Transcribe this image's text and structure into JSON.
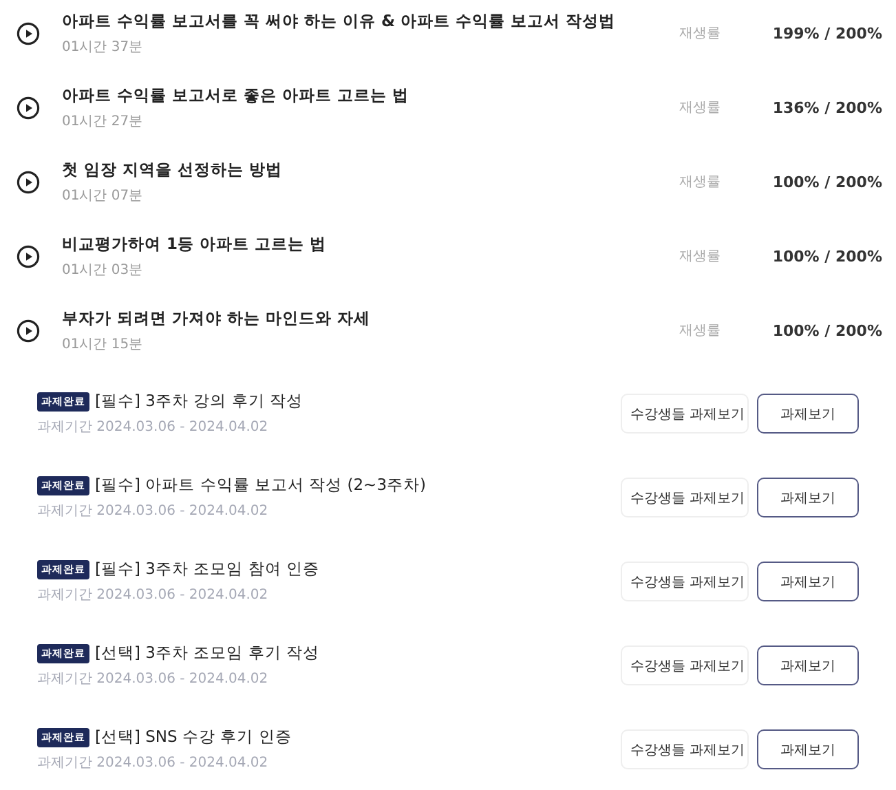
{
  "lectures": [
    {
      "title": "아파트 수익률 보고서를 꼭 써야 하는 이유 & 아파트 수익률 보고서 작성법",
      "duration": "01시간 37분",
      "rate_label": "재생률",
      "rate": "199% / 200%"
    },
    {
      "title": "아파트 수익률 보고서로 좋은 아파트 고르는 법",
      "duration": "01시간 27분",
      "rate_label": "재생률",
      "rate": "136% / 200%"
    },
    {
      "title": "첫 임장 지역을 선정하는 방법",
      "duration": "01시간 07분",
      "rate_label": "재생률",
      "rate": "100% / 200%"
    },
    {
      "title": "비교평가하여 1등 아파트 고르는 법",
      "duration": "01시간 03분",
      "rate_label": "재생률",
      "rate": "100% / 200%"
    },
    {
      "title": "부자가 되려면 가져야 하는 마인드와 자세",
      "duration": "01시간 15분",
      "rate_label": "재생률",
      "rate": "100% / 200%"
    }
  ],
  "assignments": [
    {
      "badge": "과제완료",
      "title": "[필수] 3주차 강의 후기 작성",
      "period": "과제기간 2024.03.06 - 2024.04.02",
      "peer_button": "수강생들 과제보기",
      "view_button": "과제보기"
    },
    {
      "badge": "과제완료",
      "title": "[필수] 아파트 수익률 보고서 작성 (2~3주차)",
      "period": "과제기간 2024.03.06 - 2024.04.02",
      "peer_button": "수강생들 과제보기",
      "view_button": "과제보기"
    },
    {
      "badge": "과제완료",
      "title": "[필수] 3주차 조모임 참여 인증",
      "period": "과제기간 2024.03.06 - 2024.04.02",
      "peer_button": "수강생들 과제보기",
      "view_button": "과제보기"
    },
    {
      "badge": "과제완료",
      "title": "[선택] 3주차 조모임 후기 작성",
      "period": "과제기간 2024.03.06 - 2024.04.02",
      "peer_button": "수강생들 과제보기",
      "view_button": "과제보기"
    },
    {
      "badge": "과제완료",
      "title": "[선택] SNS 수강 후기 인증",
      "period": "과제기간 2024.03.06 - 2024.04.02",
      "peer_button": "수강생들 과제보기",
      "view_button": "과제보기"
    }
  ]
}
